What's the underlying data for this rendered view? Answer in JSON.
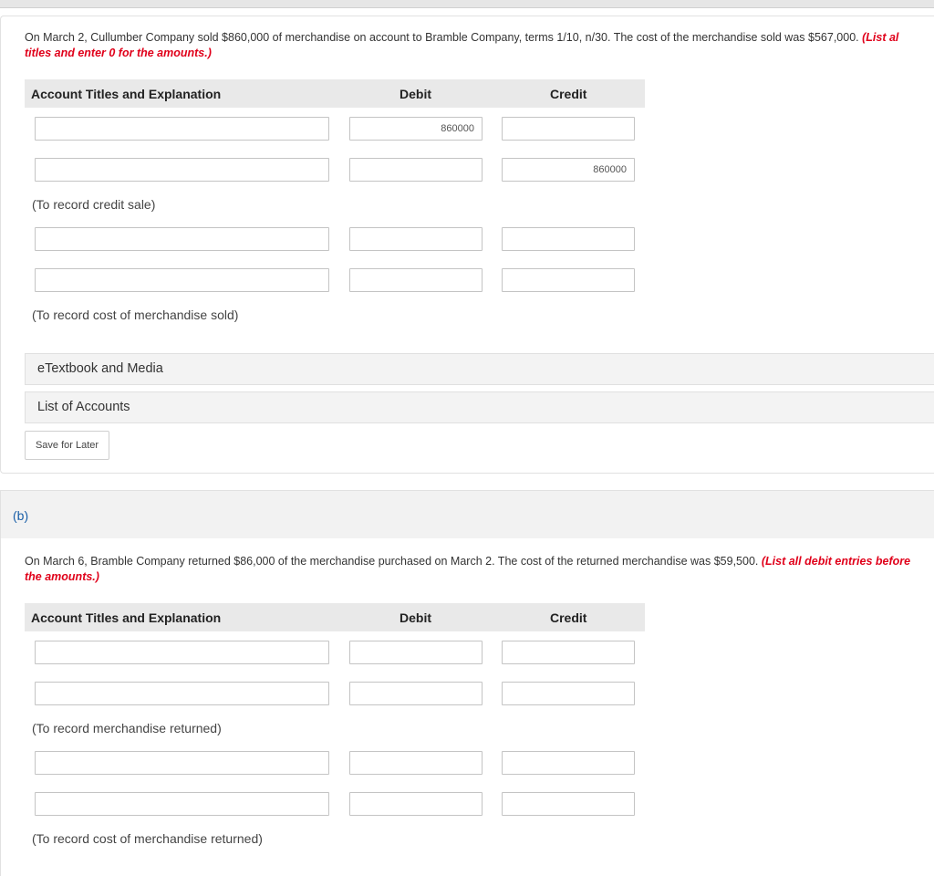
{
  "part_a": {
    "question_text": "On March 2, Cullumber Company sold $860,000 of merchandise on account to Bramble Company, terms 1/10, n/30. The cost of the merchandise sold was $567,000. ",
    "instruction_line1": "(List al",
    "instruction_line2": "titles and enter 0 for the amounts.)",
    "table_headers": {
      "account": "Account Titles and Explanation",
      "debit": "Debit",
      "credit": "Credit"
    },
    "rows": [
      {
        "account": "",
        "debit": "860000",
        "credit": ""
      },
      {
        "account": "",
        "debit": "",
        "credit": "860000"
      },
      {
        "account": "",
        "debit": "",
        "credit": ""
      },
      {
        "account": "",
        "debit": "",
        "credit": ""
      }
    ],
    "notes": [
      "(To record credit sale)",
      "(To record cost of merchandise sold)"
    ],
    "etextbook_label": "eTextbook and Media",
    "list_accounts_label": "List of Accounts",
    "save_label": "Save for Later"
  },
  "part_b": {
    "section_label": "(b)",
    "question_text": "On March 6, Bramble Company returned $86,000 of the merchandise purchased on March 2. The cost of the returned merchandise was $59,500. ",
    "instruction_line1": "(List all debit entries before",
    "instruction_line2": "the amounts.)",
    "table_headers": {
      "account": "Account Titles and Explanation",
      "debit": "Debit",
      "credit": "Credit"
    },
    "rows": [
      {
        "account": "",
        "debit": "",
        "credit": ""
      },
      {
        "account": "",
        "debit": "",
        "credit": ""
      },
      {
        "account": "",
        "debit": "",
        "credit": ""
      },
      {
        "account": "",
        "debit": "",
        "credit": ""
      }
    ],
    "notes": [
      "(To record merchandise returned)",
      "(To record cost of merchandise returned)"
    ]
  }
}
